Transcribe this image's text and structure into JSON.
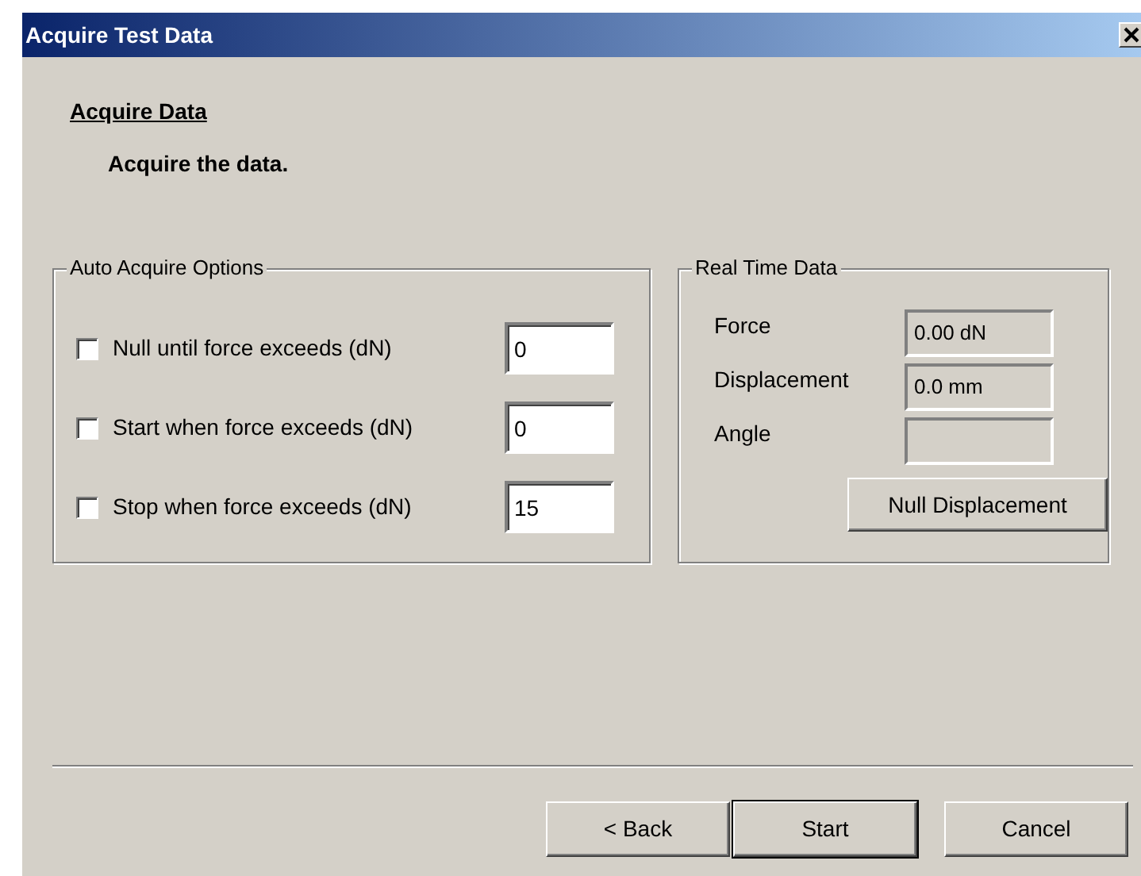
{
  "window": {
    "title": "Acquire Test Data"
  },
  "header": {
    "title": "Acquire Data",
    "subtitle": "Acquire the data."
  },
  "auto_acquire": {
    "title": "Auto Acquire Options",
    "options": [
      {
        "label": "Null until force exceeds (dN)",
        "checked": false,
        "value": "0"
      },
      {
        "label": "Start when force exceeds (dN)",
        "checked": false,
        "value": "0"
      },
      {
        "label": "Stop when force exceeds (dN)",
        "checked": false,
        "value": "15"
      }
    ]
  },
  "real_time": {
    "title": "Real Time Data",
    "readings": [
      {
        "label": "Force",
        "value": "0.00 dN"
      },
      {
        "label": "Displacement",
        "value": "0.0 mm"
      },
      {
        "label": "Angle"
      }
    ],
    "button": "Null Displacement"
  },
  "buttons": [
    {
      "label": "< Back",
      "default": false
    },
    {
      "label": "Start",
      "default": true
    },
    {
      "label": "Cancel",
      "default": false
    }
  ]
}
